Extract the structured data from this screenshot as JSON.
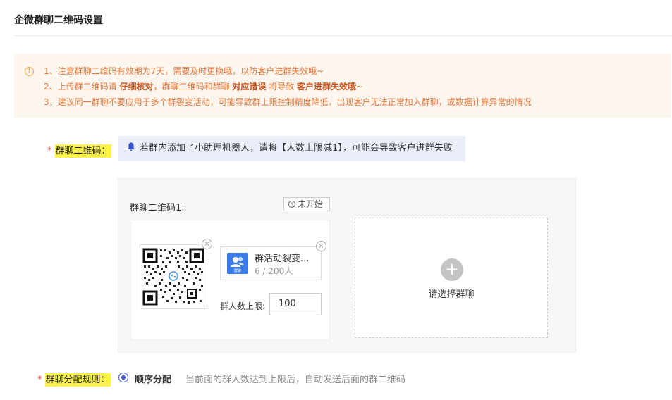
{
  "page_title": "企微群聊二维码设置",
  "notice": {
    "line1": "1、注意群聊二维码有效期为7天，需要及时更换哦，以防客户进群失效哦~",
    "line2_a": "2、上传群二维码请 ",
    "line2_b": "仔细核对",
    "line2_c": "，群聊二维码和群聊 ",
    "line2_d": "对应错误",
    "line2_e": " 将导致 ",
    "line2_f": "客户进群失效哦",
    "line2_g": "~",
    "line3": "3、建议同一群聊不要应用于多个群裂变活动，可能导致群上限控制精度降低，出现客户无法正常加入群聊，或数据计算异常的情况"
  },
  "qr_field": {
    "required_mark": "*",
    "label": "群聊二维码：",
    "tip": "若群内添加了小助理机器人，请将【人数上限减1】，可能会导致客户进群失败"
  },
  "panel": {
    "qr_label": "群聊二维码1:",
    "status": "未开始",
    "close_symbol": "×",
    "group_name": "群活动裂变...",
    "group_icon_text": "群聊",
    "group_count": "6 / 200人",
    "limit_label": "群人数上限:",
    "limit_value": "100",
    "add_symbol": "+",
    "add_label": "请选择群聊"
  },
  "rule_field": {
    "required_mark": "*",
    "label": "群聊分配规则：",
    "option_label": "顺序分配",
    "option_desc": "当前面的群人数达到上限后，自动发送后面的群二维码"
  },
  "colors": {
    "warning_text": "#e5773a",
    "notice_bg": "#fdf6ef",
    "highlight": "#fbf34b",
    "accent": "#3b55c9",
    "group_icon": "#3b7be8"
  }
}
